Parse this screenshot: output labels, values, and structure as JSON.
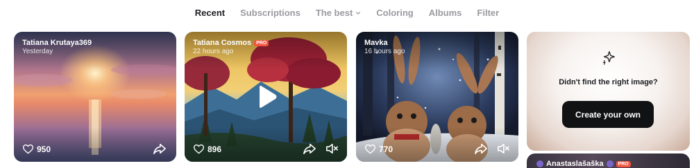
{
  "tabs": [
    {
      "label": "Recent",
      "active": true
    },
    {
      "label": "Subscriptions",
      "active": false
    },
    {
      "label": "The best",
      "active": false,
      "dropdown": true
    },
    {
      "label": "Coloring",
      "active": false
    },
    {
      "label": "Albums",
      "active": false
    },
    {
      "label": "Filter",
      "active": false
    }
  ],
  "cards": [
    {
      "author": "Tatiana Krutaya369",
      "time": "Yesterday",
      "likes": "950",
      "pro": false,
      "scene": "sunset over water"
    },
    {
      "author": "Tatiana Cosmos",
      "time": "22 hours ago",
      "likes": "896",
      "pro": true,
      "pro_label": "PRO",
      "scene": "autumn forest with mountains",
      "video": true
    },
    {
      "author": "Mavka",
      "time": "16 hours ago",
      "likes": "770",
      "pro": false,
      "scene": "rabbits in snowy forest",
      "video": true
    }
  ],
  "promo": {
    "question": "Didn't find the right image?",
    "cta": "Create your own"
  },
  "peek_card": {
    "author": "Anastaslašaška",
    "pro_label": "PRO"
  },
  "colors": {
    "pro": "#f3533f",
    "cta_bg": "#111214",
    "active_tab": "#1d1d22",
    "inactive_tab": "#9a9aa0"
  }
}
